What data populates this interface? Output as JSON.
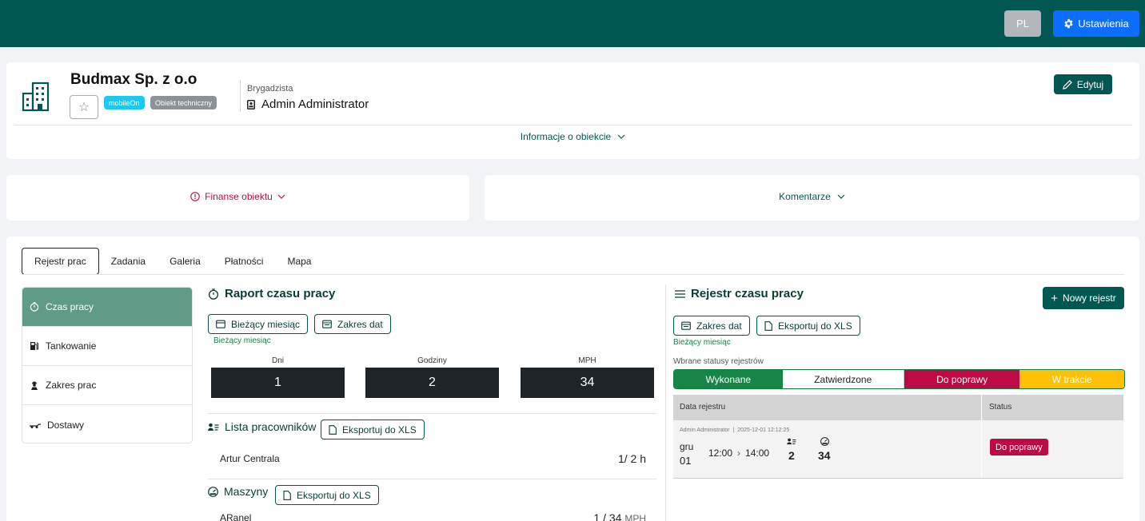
{
  "topbar": {
    "lang_label": "PL",
    "settings_label": "Ustawienia",
    "background_color": "#035752",
    "settings_color": "#0d6efd"
  },
  "header": {
    "company_name": "Budmax Sp. z o.o",
    "badges": [
      "mobileOn",
      "Obiekt techniczny"
    ],
    "role_label": "Brygadzista",
    "person_name": "Admin Administrator",
    "edit_label": "Edytuj",
    "info_toggle_label": "Informacje o obiekcie"
  },
  "finance": {
    "label": "Finanse obiektu"
  },
  "comments": {
    "label": "Komentarze"
  },
  "tabs": [
    "Rejestr prac",
    "Zadania",
    "Galeria",
    "Płatności",
    "Mapa"
  ],
  "active_tab": "Rejestr prac",
  "sidebar": {
    "items": [
      {
        "label": "Czas pracy",
        "icon": "stopwatch-icon",
        "active": true
      },
      {
        "label": "Tankowanie",
        "icon": "fuel-pump-icon",
        "active": false
      },
      {
        "label": "Zakres prac",
        "icon": "worker-icon",
        "active": false
      },
      {
        "label": "Dostawy",
        "icon": "delivery-icon",
        "active": false
      }
    ]
  },
  "report": {
    "title": "Raport czasu pracy",
    "btn_current_month": "Bieżący miesiąc",
    "btn_date_range": "Zakres dat",
    "hint": "Bieżący miesiąc",
    "stats": [
      {
        "label": "Dni",
        "value": "1"
      },
      {
        "label": "Godziny",
        "value": "2"
      },
      {
        "label": "MPH",
        "value": "34"
      }
    ],
    "employees": {
      "title": "Lista pracowników",
      "export_label": "Eksportuj do XLS",
      "rows": [
        {
          "name": "Artur Centrala",
          "value": "1/ 2",
          "unit": "h"
        }
      ]
    },
    "machines": {
      "title": "Maszyny",
      "export_label": "Eksportuj do XLS",
      "rows": [
        {
          "name": "ARanel",
          "value": "1 / 34",
          "unit": "MPH"
        }
      ]
    }
  },
  "register": {
    "title": "Rejestr czasu pracy",
    "new_label": "Nowy rejestr",
    "btn_date_range": "Zakres dat",
    "btn_export": "Eksportuj do XLS",
    "hint": "Bieżący miesiąc",
    "status_filter_label": "Wbrane statusy rejestrów",
    "statuses": [
      {
        "label": "Wykonane",
        "color": "#188547"
      },
      {
        "label": "Zatwierdzone",
        "color": "#ffffff"
      },
      {
        "label": "Do poprawy",
        "color": "#bd0a44"
      },
      {
        "label": "W trakcie",
        "color": "#ffc107"
      }
    ],
    "columns": [
      "Data rejestru",
      "Status"
    ],
    "rows": [
      {
        "meta_author": "Admin Administrator",
        "meta_sep": "|",
        "meta_timestamp": "2025-12-01 12:12:25",
        "month": "gru",
        "day": "01",
        "time_from": "12:00",
        "time_to": "14:00",
        "workers": "2",
        "mph": "34",
        "status": "Do poprawy"
      }
    ]
  }
}
